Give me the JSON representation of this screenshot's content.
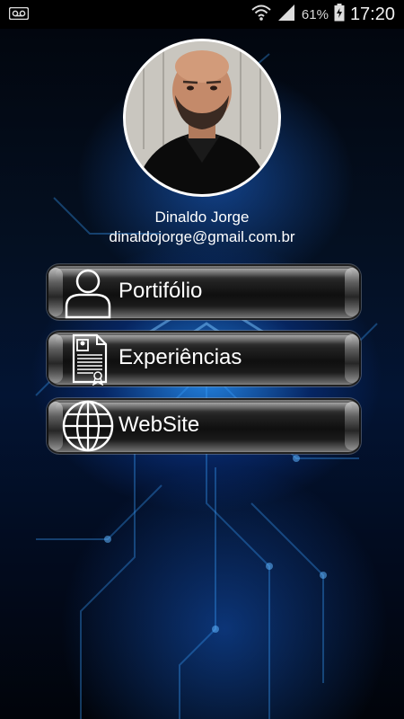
{
  "status_bar": {
    "left_icon": "voicemail-icon",
    "wifi_icon": "wifi-icon",
    "signal_icon": "signal-icon",
    "battery_percent": "61%",
    "battery_icon": "battery-charging-icon",
    "time": "17:20"
  },
  "profile": {
    "avatar_icon": "profile-photo",
    "name": "Dinaldo Jorge",
    "email": "dinaldojorge@gmail.com.br"
  },
  "menu": [
    {
      "label": "Portifólio",
      "icon": "person-icon"
    },
    {
      "label": "Experiências",
      "icon": "resume-document-icon"
    },
    {
      "label": "WebSite",
      "icon": "globe-icon"
    }
  ],
  "colors": {
    "background": "#000000",
    "accent_glow": "#2a8cff",
    "button_chrome": "#8a8a8a",
    "text": "#ffffff"
  }
}
